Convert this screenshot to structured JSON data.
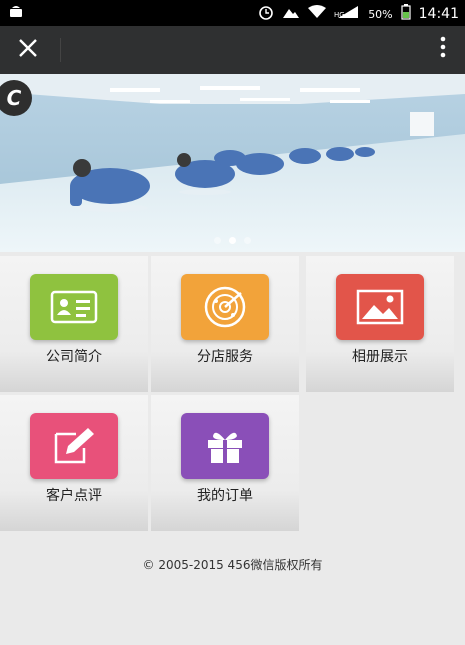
{
  "status_bar": {
    "battery": "50%",
    "time": "14:41",
    "icons": [
      "android-debug-icon",
      "alarm-icon",
      "photo-icon",
      "wifi-icon",
      "signal-icon",
      "battery-icon"
    ]
  },
  "app_bar": {
    "close_icon": "close-icon",
    "more_icon": "more-vertical-icon"
  },
  "banner": {
    "slides": 3,
    "active_slide": 2
  },
  "menu": {
    "items": [
      {
        "label": "公司简介",
        "color": "#8fc23f",
        "icon": "id-card-icon"
      },
      {
        "label": "分店服务",
        "color": "#f2a33a",
        "icon": "radar-icon"
      },
      {
        "label": "相册展示",
        "color": "#e2554a",
        "icon": "picture-icon"
      },
      {
        "label": "客户点评",
        "color": "#e8517a",
        "icon": "edit-icon"
      },
      {
        "label": "我的订单",
        "color": "#8a4fb8",
        "icon": "gift-icon"
      }
    ]
  },
  "footer": {
    "copyright": "© 2005-2015 456微信版权所有"
  }
}
